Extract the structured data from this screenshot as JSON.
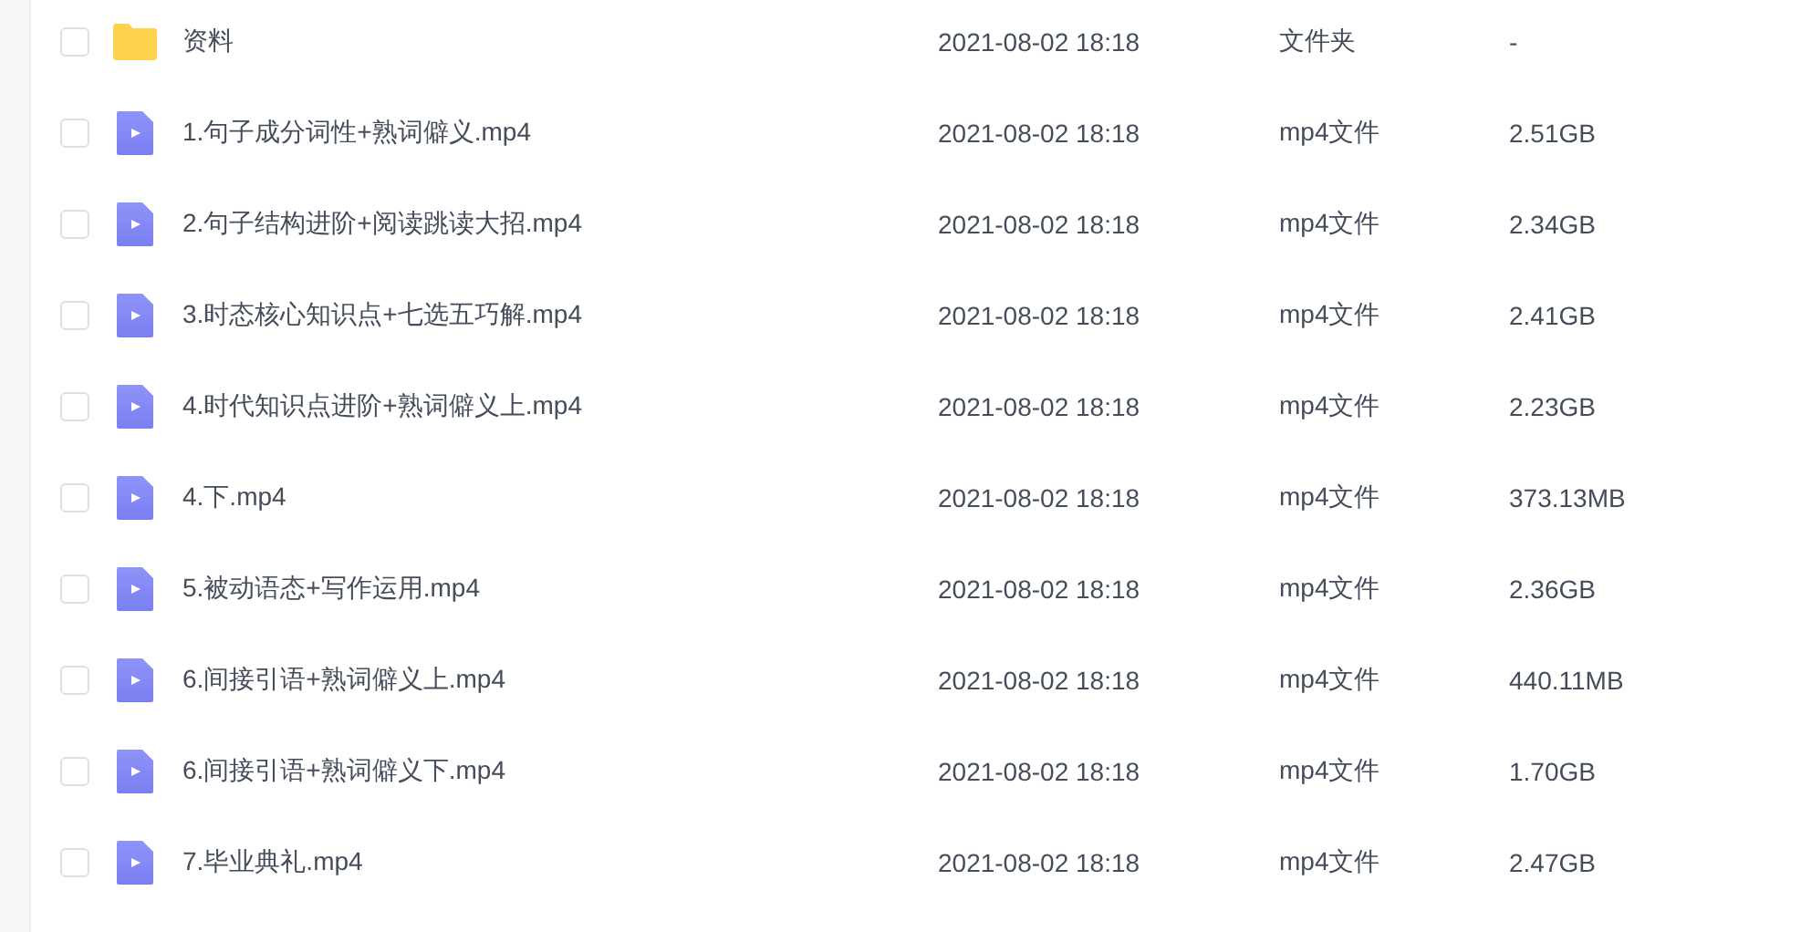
{
  "files": [
    {
      "kind": "folder",
      "name": "资料",
      "modified": "2021-08-02 18:18",
      "type": "文件夹",
      "size": "-",
      "selected": false
    },
    {
      "kind": "video",
      "name": "1.句子成分词性+熟词僻义.mp4",
      "modified": "2021-08-02 18:18",
      "type": "mp4文件",
      "size": "2.51GB",
      "selected": false
    },
    {
      "kind": "video",
      "name": "2.句子结构进阶+阅读跳读大招.mp4",
      "modified": "2021-08-02 18:18",
      "type": "mp4文件",
      "size": "2.34GB",
      "selected": false
    },
    {
      "kind": "video",
      "name": "3.时态核心知识点+七选五巧解.mp4",
      "modified": "2021-08-02 18:18",
      "type": "mp4文件",
      "size": "2.41GB",
      "selected": false
    },
    {
      "kind": "video",
      "name": "4.时代知识点进阶+熟词僻义上.mp4",
      "modified": "2021-08-02 18:18",
      "type": "mp4文件",
      "size": "2.23GB",
      "selected": false
    },
    {
      "kind": "video",
      "name": "4.下.mp4",
      "modified": "2021-08-02 18:18",
      "type": "mp4文件",
      "size": "373.13MB",
      "selected": false
    },
    {
      "kind": "video",
      "name": "5.被动语态+写作运用.mp4",
      "modified": "2021-08-02 18:18",
      "type": "mp4文件",
      "size": "2.36GB",
      "selected": false
    },
    {
      "kind": "video",
      "name": "6.间接引语+熟词僻义上.mp4",
      "modified": "2021-08-02 18:18",
      "type": "mp4文件",
      "size": "440.11MB",
      "selected": false
    },
    {
      "kind": "video",
      "name": "6.间接引语+熟词僻义下.mp4",
      "modified": "2021-08-02 18:18",
      "type": "mp4文件",
      "size": "1.70GB",
      "selected": false
    },
    {
      "kind": "video",
      "name": "7.毕业典礼.mp4",
      "modified": "2021-08-02 18:18",
      "type": "mp4文件",
      "size": "2.47GB",
      "selected": false
    }
  ]
}
